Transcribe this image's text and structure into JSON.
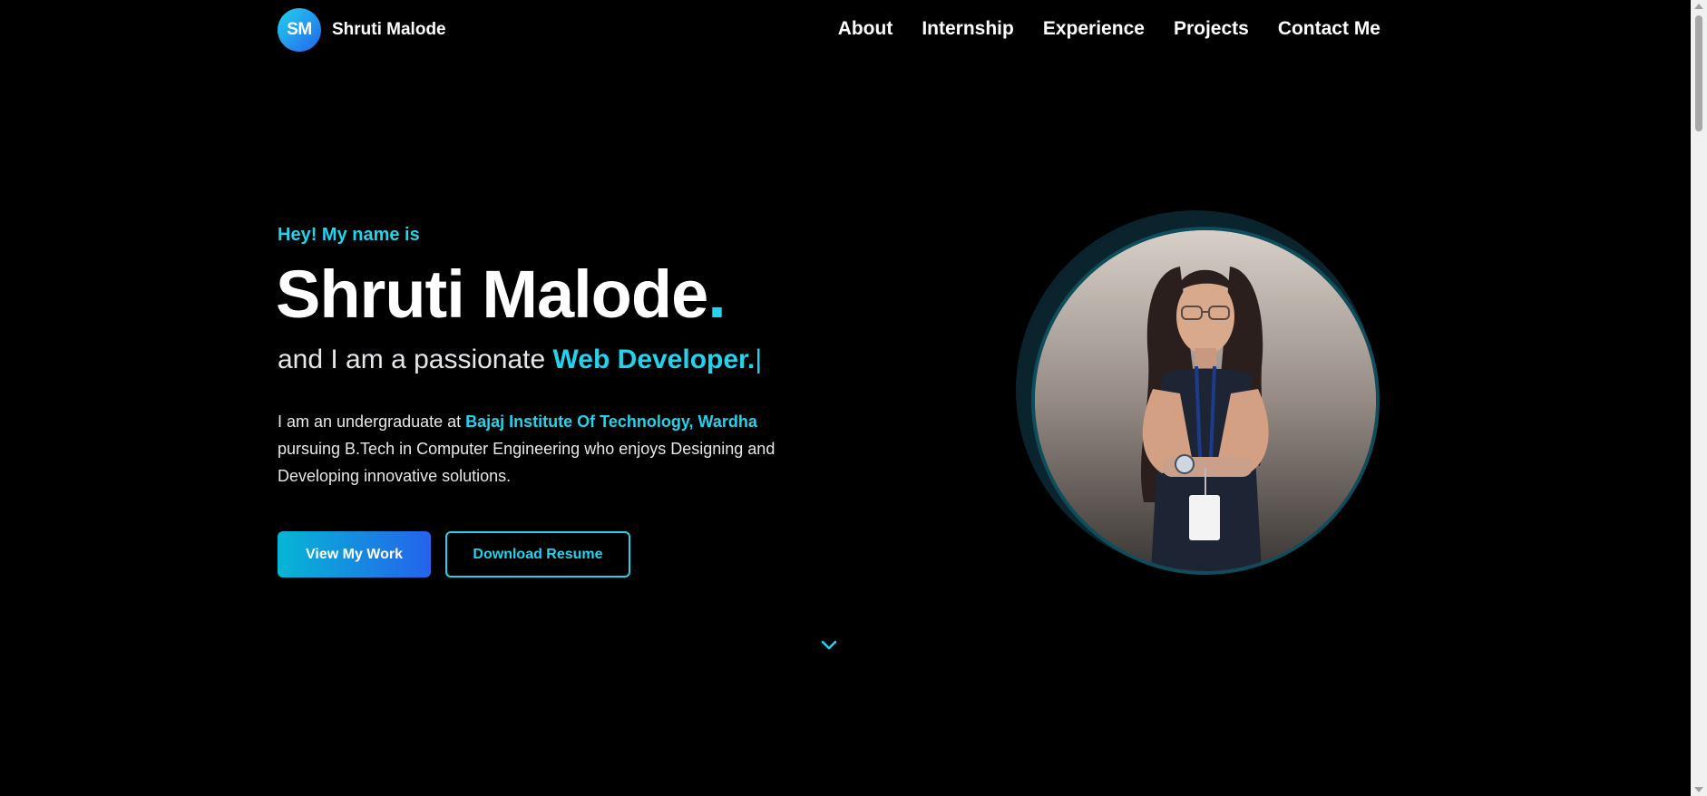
{
  "header": {
    "logo_initials": "SM",
    "logo_name": "Shruti Malode",
    "nav": [
      "About",
      "Internship",
      "Experience",
      "Projects",
      "Contact Me"
    ]
  },
  "hero": {
    "greeting": "Hey! My name is",
    "name": "Shruti Malode",
    "name_dot": ".",
    "tagline_prefix": "and I am a passionate ",
    "tagline_role": "Web Developer.",
    "tagline_cursor": "|",
    "bio_prefix": "I am an undergraduate at ",
    "bio_institution": "Bajaj Institute Of Technology, Wardha",
    "bio_rest": " pursuing B.Tech in Computer Engineering who enjoys Designing and Developing innovative solutions.",
    "primary_button": "View My Work",
    "secondary_button": "Download Resume",
    "scroll_icon": "chevron-down-icon",
    "portrait_icon": "profile-photo"
  },
  "colors": {
    "background": "#000000",
    "accent": "#22d3ee",
    "gradient_start": "#06b6d4",
    "gradient_end": "#2563eb",
    "text": "#ffffff"
  }
}
